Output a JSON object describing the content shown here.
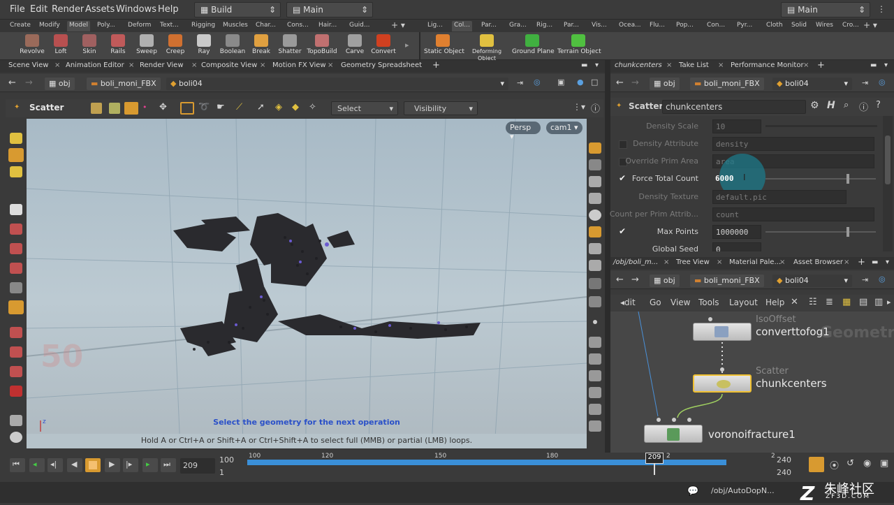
{
  "menu": {
    "items": [
      "File",
      "Edit",
      "Render",
      "Assets",
      "Windows",
      "Help"
    ],
    "desktop_left": "Build",
    "desktop_mid": "Main",
    "desktop_right": "Main"
  },
  "shelf_tabs_left": [
    "Create",
    "Modify",
    "Model",
    "Poly...",
    "Deform",
    "Text...",
    "Rigging",
    "Muscles",
    "Char...",
    "Cons...",
    "Hair...",
    "Guid..."
  ],
  "shelf_tabs_right": [
    "Lig...",
    "Col...",
    "Par...",
    "Gra...",
    "Rig...",
    "Par...",
    "Vis...",
    "Ocea...",
    "Flu...",
    "Pop...",
    "Con...",
    "Pyr...",
    "Cloth",
    "Solid",
    "Wires",
    "Cro..."
  ],
  "shelf_tools_left": [
    "Revolve",
    "Loft",
    "Skin",
    "Rails",
    "Sweep",
    "Creep",
    "Ray",
    "Boolean",
    "Break",
    "Shatter",
    "TopoBuild",
    "Carve",
    "Convert"
  ],
  "shelf_tools_right": [
    "Static Object",
    "Deforming Object",
    "Ground Plane",
    "Terrain Object"
  ],
  "left_pane": {
    "tabs": [
      "Scene View",
      "Animation Editor",
      "Render View",
      "Composite View",
      "Motion FX View",
      "Geometry Spreadsheet"
    ],
    "path": [
      "obj",
      "boli_moni_FBX",
      "boli04"
    ],
    "operator": "Scatter",
    "select_label": "Select",
    "visibility_label": "Visibility"
  },
  "viewport": {
    "camera_menu": "Persp",
    "cam": "cam1",
    "prompt": "Select the geometry for the next operation",
    "hint": "Hold A or Ctrl+A or Shift+A or Ctrl+Shift+A to select full (MMB) or partial (LMB) loops.",
    "axis_label": "z"
  },
  "params_pane": {
    "tabs": [
      "chunkcenters",
      "Take List",
      "Performance Monitor"
    ],
    "path": [
      "obj",
      "boli_moni_FBX",
      "boli04"
    ],
    "node_type": "Scatter",
    "node_name": "chunkcenters",
    "rows": [
      {
        "label": "Density Scale",
        "value": "10",
        "enabled": false,
        "check": "none"
      },
      {
        "label": "Density Attribute",
        "value": "density",
        "enabled": false,
        "check": "empty"
      },
      {
        "label": "Override Prim Area",
        "value": "area",
        "enabled": false,
        "check": "empty"
      },
      {
        "label": "Force Total Count",
        "value": "6000",
        "enabled": true,
        "check": "checked"
      },
      {
        "label": "Density Texture",
        "value": "default.pic",
        "enabled": false,
        "check": "none"
      },
      {
        "label": "Count per Prim Attrib...",
        "value": "count",
        "enabled": false,
        "check": "none"
      },
      {
        "label": "Max Points",
        "value": "1000000",
        "enabled": true,
        "check": "checked"
      },
      {
        "label": "Global Seed",
        "value": "0",
        "enabled": true,
        "check": "none"
      }
    ]
  },
  "network_pane": {
    "tabs": [
      "/obj/boli_m...",
      "Tree View",
      "Material Pale...",
      "Asset Browser"
    ],
    "path": [
      "obj",
      "boli_moni_FBX",
      "boli04"
    ],
    "menus": [
      "dit",
      "Go",
      "View",
      "Tools",
      "Layout",
      "Help"
    ],
    "watermark": "Geometry",
    "nodes": [
      {
        "type": "IsoOffset",
        "name": "converttofog1"
      },
      {
        "type": "Scatter",
        "name": "chunkcenters"
      },
      {
        "type": "",
        "name": "voronoifracture1"
      }
    ]
  },
  "timeline": {
    "current_frame": "209",
    "start": "100",
    "step": "1",
    "end": "240",
    "end2": "240",
    "ticks": [
      "100",
      "120",
      "150",
      "180",
      "209",
      "2"
    ],
    "marker": "209"
  },
  "status": {
    "path": "/obj/AutoDopN..."
  },
  "watermark": {
    "brand": "朱峰社区",
    "url": "ZF3D.COM"
  },
  "colors": {
    "accent": "#e3a63a",
    "timeline_blue": "#3a8fd8",
    "node_selected": "#f0c030"
  }
}
